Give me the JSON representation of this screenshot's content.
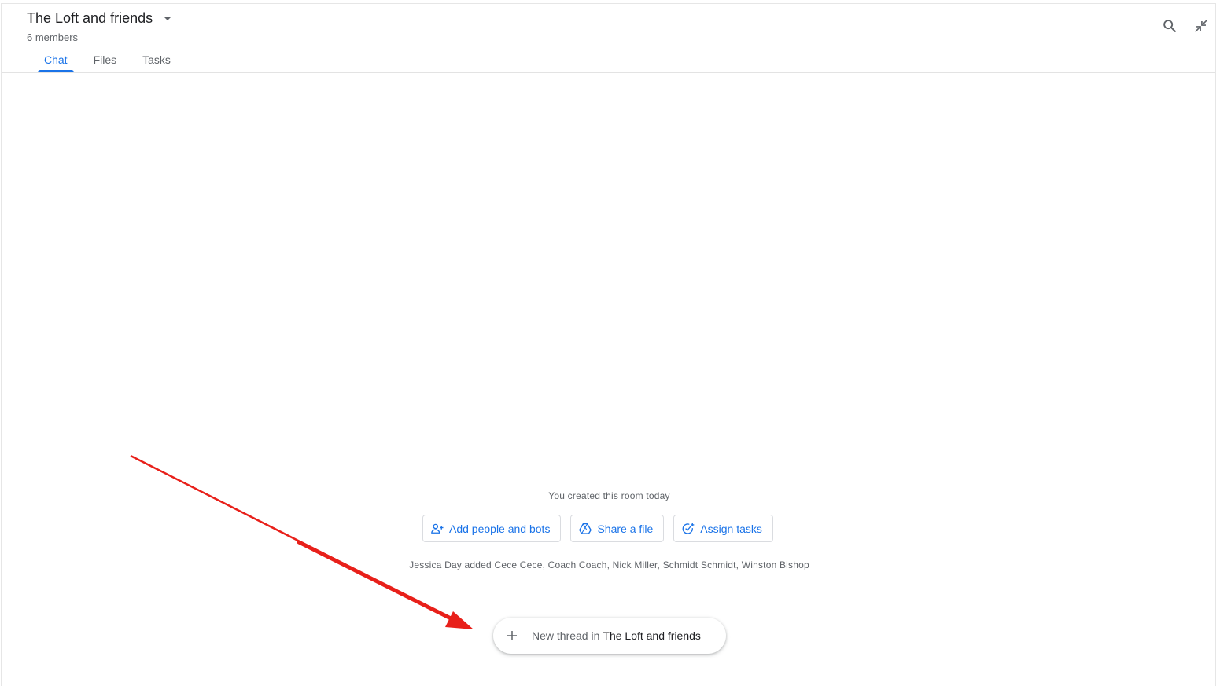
{
  "header": {
    "room_title": "The Loft and friends",
    "members": "6 members",
    "tabs": [
      {
        "label": "Chat",
        "active": true
      },
      {
        "label": "Files",
        "active": false
      },
      {
        "label": "Tasks",
        "active": false
      }
    ],
    "icons": [
      "search-icon",
      "collapse-icon"
    ]
  },
  "main": {
    "created_text": "You created this room today",
    "actions": [
      {
        "label": "Add people and bots",
        "icon": "add-person-icon"
      },
      {
        "label": "Share a file",
        "icon": "drive-icon"
      },
      {
        "label": "Assign tasks",
        "icon": "add-task-icon"
      }
    ],
    "added_text": "Jessica Day added Cece Cece, Coach Coach, Nick Miller, Schmidt Schmidt, Winston Bishop",
    "new_thread": {
      "prefix": "New thread in",
      "room": "The Loft and friends"
    }
  },
  "colors": {
    "accent": "#1a73e8",
    "annotation_arrow": "#e8201a"
  }
}
